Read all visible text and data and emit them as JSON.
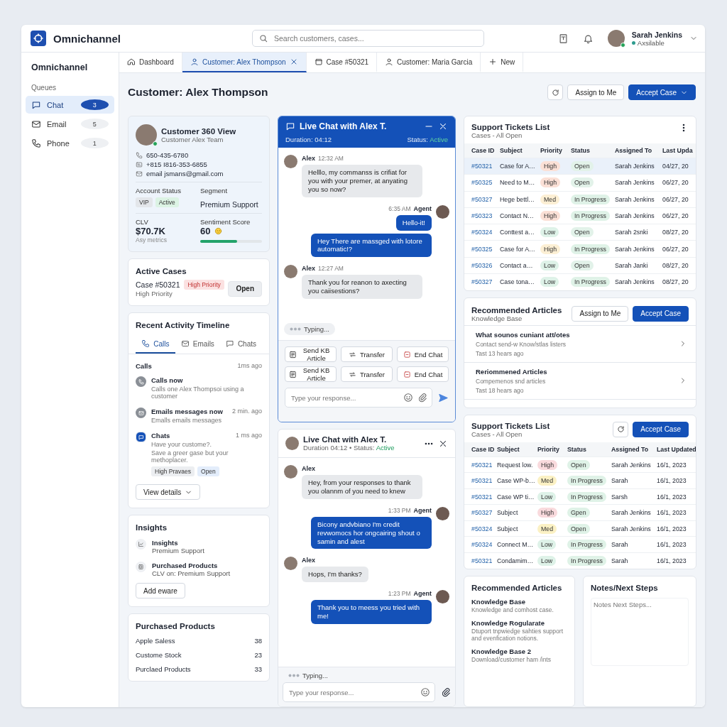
{
  "app": {
    "name": "Omnichannel"
  },
  "search": {
    "placeholder": "Search customers, cases..."
  },
  "user": {
    "name": "Sarah Jenkins",
    "status": "Axsilable"
  },
  "sidebar": {
    "title": "Omnichannel",
    "section": "Queues",
    "items": [
      {
        "label": "Chat",
        "count": "3",
        "kind": "chat",
        "selected": true
      },
      {
        "label": "Email",
        "count": "5",
        "kind": "email",
        "selected": false
      },
      {
        "label": "Phone",
        "count": "1",
        "kind": "phone",
        "selected": false
      }
    ]
  },
  "tabs": [
    {
      "label": "Dashboard",
      "kind": "dashboard",
      "selected": false,
      "closable": false
    },
    {
      "label": "Customer: Alex Thompson",
      "kind": "customer",
      "selected": true,
      "closable": true
    },
    {
      "label": "Case #50321",
      "kind": "case",
      "selected": false,
      "closable": false
    },
    {
      "label": "Customer: Maria Garcia",
      "kind": "customer",
      "selected": false,
      "closable": false
    },
    {
      "label": "New",
      "kind": "new",
      "selected": false,
      "closable": false
    }
  ],
  "page_title": "Customer: Alex Thompson",
  "header_buttons": {
    "secondary": "Assign to Me",
    "primary": "Accept Case"
  },
  "customer_card": {
    "title": "Customer 360 View",
    "subtitle": "Customer Alex Team",
    "contacts": [
      {
        "kind": "phone",
        "text": "650-435-6780"
      },
      {
        "kind": "card",
        "text": "+815 I816-353-6855"
      },
      {
        "kind": "email",
        "text": "email jsmans@gmail.com"
      }
    ],
    "account_status": {
      "label": "Account Status",
      "tags": [
        {
          "text": "VIP",
          "color": "#e3e6ea"
        },
        {
          "text": "Active",
          "color": "#dcf3e4"
        }
      ]
    },
    "segment": {
      "label": "Segment",
      "value": "Premium Support"
    },
    "clv": {
      "label": "CLV",
      "value": "$70.7K",
      "note": "Asy metrics"
    },
    "sentiment": {
      "label": "Sentiment Score",
      "value": "60",
      "level": 0.6
    }
  },
  "active_cases": {
    "title": "Active Cases",
    "case": "Case #50321",
    "tag": "High Priority",
    "note": "High Priority",
    "button": "Open"
  },
  "timeline": {
    "title": "Recent Activity Timeline",
    "tabs": [
      {
        "label": "Calls",
        "kind": "call",
        "selected": true
      },
      {
        "label": "Emails",
        "kind": "email",
        "selected": false
      },
      {
        "label": "Chats",
        "kind": "chat",
        "selected": false
      }
    ],
    "section": "Calls",
    "section_time": "1ms ago",
    "items": [
      {
        "kind": "call",
        "title": "Calls now",
        "lines": [
          "Calls one Alex Thompsoi using a customer"
        ]
      },
      {
        "kind": "email",
        "title": "Emails messages now",
        "time": "2 min. ago",
        "lines": [
          "Emalls emails messages"
        ]
      },
      {
        "kind": "chat",
        "title": "Chats",
        "time": "1 ms ago",
        "lines": [
          "Have your custome?.",
          "Save a greer gase but your methoplacer."
        ],
        "tags": [
          "High Pravaes",
          "Open"
        ]
      }
    ],
    "button": "View details"
  },
  "insights": {
    "title": "Insights",
    "items": [
      {
        "kind": "chart",
        "title": "Insights",
        "text": "Premium Support"
      },
      {
        "kind": "box",
        "title": "Purchased Products",
        "text": "CLV on: Premium Support"
      }
    ],
    "button": "Add eware"
  },
  "purchased": {
    "title": "Purchased Products",
    "rows": [
      {
        "name": "Apple Saless",
        "count": "38"
      },
      {
        "name": "Custome Stock",
        "count": "23"
      },
      {
        "name": "Purclaed Products",
        "count": "33"
      }
    ]
  },
  "chat_main": {
    "title": "Live Chat with Alex T.",
    "duration": "Duration: 04:12",
    "status_label": "Status:",
    "status": "Active",
    "messages": [
      {
        "kind": "customer",
        "name": "Alex",
        "time": "12:32 AM",
        "bubbles": [
          "Helllo, my commanss is crifiat for you with your premer, at anyating you so now?"
        ]
      },
      {
        "kind": "agent",
        "name": "Agent",
        "time": "6:35 AM",
        "bubbles": [
          "Hello-it!",
          "Hey There are massged with lotore automatic!?"
        ]
      },
      {
        "kind": "customer",
        "name": "Alex",
        "time": "12:27 AM",
        "bubbles": [
          "Thank you for reanon to axecting you caiisestions?"
        ]
      }
    ],
    "typing": "Typing...",
    "actions": [
      {
        "kind": "kb",
        "label": "Send KB Article"
      },
      {
        "kind": "transfer",
        "label": "Transfer"
      },
      {
        "kind": "end",
        "label": "End Chat"
      },
      {
        "kind": "kb",
        "label": "Send KB Article"
      },
      {
        "kind": "transfer",
        "label": "Transfer"
      },
      {
        "kind": "end",
        "label": "End Chat"
      }
    ],
    "input": {
      "placeholder": "Type your response..."
    }
  },
  "chat_second": {
    "title": "Live Chat with Alex T.",
    "duration": "Duration 04:12 • Status:",
    "status": "Active",
    "messages": [
      {
        "kind": "customer",
        "name": "Alex",
        "bubbles": [
          "Hey, from your responses to thank you olannm of you need to knew"
        ]
      },
      {
        "kind": "agent",
        "name": "Agent",
        "time": "1:33 PM",
        "bubbles": [
          "Bicony andvbiano I'm credit revwomocs hor ongcairing shout o samin and alest"
        ]
      },
      {
        "kind": "customer",
        "name": "Alex",
        "bubbles": [
          "Hops, I'm thanks?"
        ]
      },
      {
        "kind": "agent",
        "name": "Agent",
        "time": "1:23 PM",
        "bubbles": [
          "Thank you to meess you tried with me!"
        ]
      }
    ],
    "typing": "Typing...",
    "input": {
      "placeholder": "Type your response..."
    }
  },
  "tickets": {
    "title": "Support Tickets List",
    "subtitle": "Cases - All Open",
    "columns": [
      "Case ID",
      "Subject",
      "Priority",
      "Status",
      "Assigned To",
      "Last Upda"
    ],
    "rows": [
      {
        "selected": true,
        "id": "#50321",
        "subject": "Case for A…",
        "priority": {
          "text": "High",
          "color": "#fbe0d6"
        },
        "status": {
          "text": "Open",
          "color": "#e2f2e9"
        },
        "assigned": "Sarah Jenkins",
        "updated": "04/27, 20"
      },
      {
        "selected": false,
        "id": "#50325",
        "subject": "Need to M…",
        "priority": {
          "text": "High",
          "color": "#fbe0d6"
        },
        "status": {
          "text": "Open",
          "color": "#e2f2e9"
        },
        "assigned": "Sarah Jenkins",
        "updated": "06/27, 20"
      },
      {
        "selected": false,
        "id": "#50327",
        "subject": "Hege bettl…",
        "priority": {
          "text": "Med",
          "color": "#fcefd4"
        },
        "status": {
          "text": "In Progress",
          "color": "#dff2e7"
        },
        "assigned": "Sarah Jenkins",
        "updated": "06/27, 20"
      },
      {
        "selected": false,
        "id": "#50323",
        "subject": "Contact N…",
        "priority": {
          "text": "High",
          "color": "#fbe0d6"
        },
        "status": {
          "text": "In Progress",
          "color": "#dff2e7"
        },
        "assigned": "Sarah Jenkins",
        "updated": "06/27, 20"
      },
      {
        "selected": false,
        "id": "#50324",
        "subject": "Conttest a…",
        "priority": {
          "text": "Low",
          "color": "#def2e8"
        },
        "status": {
          "text": "Open",
          "color": "#e2f2e9"
        },
        "assigned": "Sarah 2snki",
        "updated": "08/27, 20"
      },
      {
        "selected": false,
        "id": "#50325",
        "subject": "Case for A…",
        "priority": {
          "text": "High",
          "color": "#fcefd4"
        },
        "status": {
          "text": "In Progress",
          "color": "#dff2e7"
        },
        "assigned": "Sarah Jenkins",
        "updated": "06/27, 20"
      },
      {
        "selected": false,
        "id": "#50326",
        "subject": "Contact a…",
        "priority": {
          "text": "Low",
          "color": "#def2e8"
        },
        "status": {
          "text": "Open",
          "color": "#e2f2e9"
        },
        "assigned": "Sarah Janki",
        "updated": "08/27, 20"
      },
      {
        "selected": false,
        "id": "#50327",
        "subject": "Case tona…",
        "priority": {
          "text": "Low",
          "color": "#def2e8"
        },
        "status": {
          "text": "In Progress",
          "color": "#dff2e7"
        },
        "assigned": "Sarah Jenkins",
        "updated": "08/27, 20"
      }
    ]
  },
  "articles": {
    "title": "Recommended Articles",
    "subtitle": "Knowledge Base",
    "buttons": {
      "secondary": "Assign to Me",
      "primary": "Accept Case"
    },
    "items": [
      {
        "title": "What sounos cuniant att/otes",
        "text": "Contact send-w Know/stlas listers",
        "time": "Tast 13 hears ago"
      },
      {
        "title": "Reriommened Articles",
        "text": "Compemenos snd articles",
        "time": "Tast 18 hears ago"
      }
    ]
  },
  "tickets_second": {
    "title": "Support Tickets List",
    "subtitle": "Cases - All Open",
    "button": "Accept Case",
    "columns": [
      "Case ID",
      "Subject",
      "Priority",
      "Status",
      "Assigned To",
      "Last Updated"
    ],
    "rows": [
      {
        "id": "#50321",
        "subject": "Request low.",
        "priority": {
          "text": "High",
          "color": "#f9dadd"
        },
        "status": {
          "text": "Open",
          "color": "#dff2e7"
        },
        "assigned": "Sarah Jenkins",
        "updated": "16/1, 2023"
      },
      {
        "id": "#50321",
        "subject": "Case WP-b…",
        "priority": {
          "text": "Med",
          "color": "#fbf1c4"
        },
        "status": {
          "text": "In Progress",
          "color": "#dff2e7"
        },
        "assigned": "Sarah",
        "updated": "16/1, 2023"
      },
      {
        "id": "#50321",
        "subject": "Case WP ti…",
        "priority": {
          "text": "Low",
          "color": "#def2e8"
        },
        "status": {
          "text": "In Progress",
          "color": "#dff2e7"
        },
        "assigned": "Sarsh",
        "updated": "16/1, 2023"
      },
      {
        "id": "#50327",
        "subject": "Subject",
        "priority": {
          "text": "High",
          "color": "#f9dadd"
        },
        "status": {
          "text": "Gpen",
          "color": "#dff2e7"
        },
        "assigned": "Sarah Jenkins",
        "updated": "16/1, 2023"
      },
      {
        "id": "#50324",
        "subject": "Subject",
        "priority": {
          "text": "Med",
          "color": "#fbf1c4"
        },
        "status": {
          "text": "Open",
          "color": "#dff2e7"
        },
        "assigned": "Sarah Jenkins",
        "updated": "16/1, 2023"
      },
      {
        "id": "#50324",
        "subject": "Connect M…",
        "priority": {
          "text": "Low",
          "color": "#def2e8"
        },
        "status": {
          "text": "In Progress",
          "color": "#dff2e7"
        },
        "assigned": "Sarah",
        "updated": "16/1, 2023"
      },
      {
        "id": "#50321",
        "subject": "Condamim…",
        "priority": {
          "text": "Low",
          "color": "#def2e8"
        },
        "status": {
          "text": "In Progress",
          "color": "#dff2e7"
        },
        "assigned": "Sarah",
        "updated": "16/1, 2023"
      }
    ]
  },
  "articles_small": {
    "title": "Recommended Articles",
    "items": [
      {
        "title": "Knowledge Base",
        "text": "Knowledge and comhost case."
      },
      {
        "title": "Knowledge Rogularate",
        "text": "Dtuport tnpwiedge sahties support and evenfication notions."
      },
      {
        "title": "Knowledge Base 2",
        "text": "Download/customer ham /ints"
      }
    ]
  },
  "notes": {
    "title": "Notes/Next Steps",
    "placeholder": "Notes Next Steps..."
  }
}
